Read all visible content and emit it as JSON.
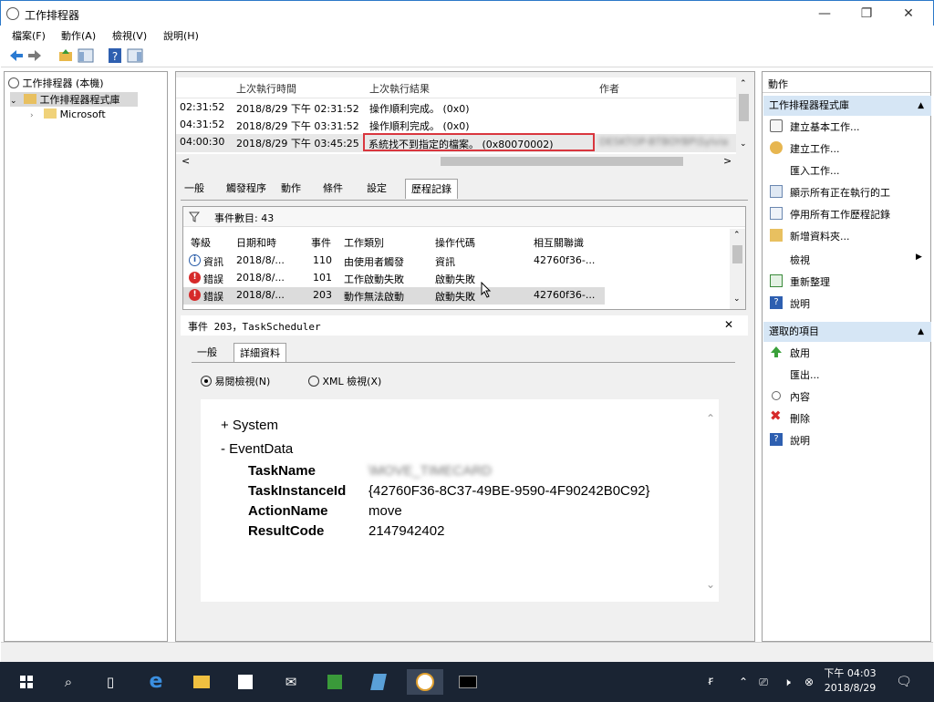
{
  "window": {
    "title": "工作排程器",
    "controls": {
      "minimize": "—",
      "restore": "❐",
      "close": "✕"
    }
  },
  "menu": [
    "檔案(F)",
    "動作(A)",
    "檢視(V)",
    "說明(H)"
  ],
  "tree": {
    "root": "工作排程器 (本機)",
    "library": "工作排程器程式庫",
    "child": "Microsoft"
  },
  "task_grid": {
    "headers": [
      "上次執行時間",
      "上次執行結果",
      "作者"
    ],
    "rows": [
      {
        "next": "02:31:52",
        "last_run": "2018/8/29 下午 02:31:52",
        "result": "操作順利完成。 (0x0)",
        "author": ""
      },
      {
        "next": "04:31:52",
        "last_run": "2018/8/29 下午 03:31:52",
        "result": "操作順利完成。 (0x0)",
        "author": ""
      },
      {
        "next": "04:00:30",
        "last_run": "2018/8/29 下午 03:45:25",
        "result": "系統找不到指定的檔案。 (0x80070002)",
        "author": "DESKTOP-BTBOYBP\\Sylvia"
      }
    ],
    "scroll_left": "<",
    "scroll_right": ">"
  },
  "tabs": [
    "一般",
    "觸發程序",
    "動作",
    "條件",
    "設定",
    "歷程記錄"
  ],
  "history": {
    "filter_label": "事件數目: 43",
    "headers": [
      "等級",
      "日期和時",
      "事件",
      "工作類別",
      "操作代碼",
      "相互關聯識"
    ],
    "rows": [
      {
        "level": "資訊",
        "date": "2018/8/...",
        "event": "110",
        "category": "由使用者觸發",
        "opcode": "資訊",
        "correlation": "42760f36-..."
      },
      {
        "level": "錯誤",
        "date": "2018/8/...",
        "event": "101",
        "category": "工作啟動失敗",
        "opcode": "啟動失敗",
        "correlation": ""
      },
      {
        "level": "錯誤",
        "date": "2018/8/...",
        "event": "203",
        "category": "動作無法啟動",
        "opcode": "啟動失敗",
        "correlation": "42760f36-..."
      }
    ]
  },
  "event_detail": {
    "header": "事件 203，TaskScheduler",
    "close": "✕",
    "tabs": [
      "一般",
      "詳細資料"
    ],
    "view_friendly": "易閱檢視(N)",
    "view_xml": "XML 檢視(X)",
    "system": "+ System",
    "eventdata": "- EventData",
    "fields": [
      {
        "key": "TaskName",
        "value": "\\MOVE_TIMECARD"
      },
      {
        "key": "TaskInstanceId",
        "value": "{42760F36-8C37-49BE-9590-4F90242B0C92}"
      },
      {
        "key": "ActionName",
        "value": "move"
      },
      {
        "key": "ResultCode",
        "value": "2147942402"
      }
    ]
  },
  "actions": {
    "title": "動作",
    "section1": "工作排程器程式庫",
    "items1": [
      "建立基本工作...",
      "建立工作...",
      "匯入工作...",
      "顯示所有正在執行的工",
      "停用所有工作歷程記錄",
      "新增資料夾...",
      "檢視",
      "重新整理",
      "說明"
    ],
    "section2": "選取的項目",
    "items2": [
      "啟用",
      "匯出...",
      "內容",
      "刪除",
      "說明"
    ]
  },
  "taskbar": {
    "time": "下午 04:03",
    "date": "2018/8/29"
  }
}
